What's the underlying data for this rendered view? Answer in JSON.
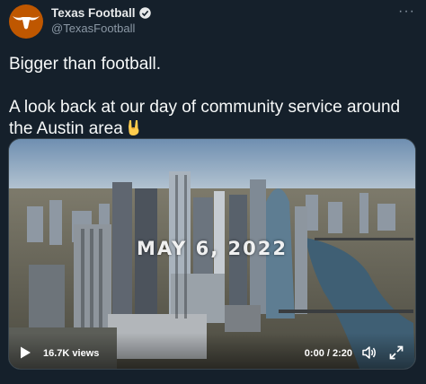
{
  "tweet": {
    "display_name": "Texas Football",
    "handle": "@TexasFootball",
    "verified_icon": "verified-badge-icon",
    "more_icon": "more-options-icon",
    "text": "Bigger than football.\n\nA look back at our day of community service around the Austin area",
    "emoji": "sign-of-the-horns"
  },
  "video": {
    "overlay_text": "MAY 6, 2022",
    "views": "16.7K views",
    "time": "0:00 / 2:20",
    "play_icon": "play-icon",
    "volume_icon": "volume-icon",
    "fullscreen_icon": "fullscreen-icon"
  },
  "colors": {
    "background": "#15202b",
    "brand_orange": "#bf5700",
    "verified_blue": "#1d9bf0",
    "secondary_text": "#8b98a5"
  }
}
